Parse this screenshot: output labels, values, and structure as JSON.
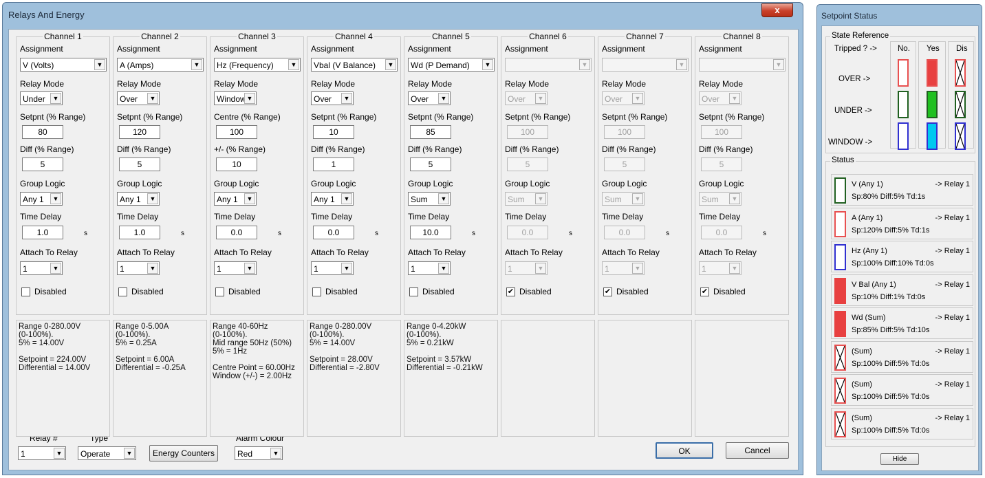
{
  "dialog": {
    "title": "Relays And Energy",
    "close_label": "x",
    "labels": {
      "assignment": "Assignment",
      "relay_mode": "Relay Mode",
      "time_delay": "Time Delay",
      "attach_to_relay": "Attach To Relay",
      "group_logic": "Group Logic",
      "disabled": "Disabled",
      "unit_seconds": "s"
    },
    "channels": [
      {
        "title": "Channel 1",
        "assignment": "V   (Volts)",
        "relay_mode": "Under",
        "sp_label": "Setpnt (% Range)",
        "sp_value": "80",
        "diff_label": "Diff (% Range)",
        "diff_value": "5",
        "group_logic": "Any 1",
        "time_delay": "1.0",
        "relay": "1",
        "disabled": false,
        "info": "Range 0-280.00V\n(0-100%).\n5% = 14.00V\n\nSetpoint = 224.00V\nDifferential = 14.00V"
      },
      {
        "title": "Channel 2",
        "assignment": "A   (Amps)",
        "relay_mode": "Over",
        "sp_label": "Setpnt (% Range)",
        "sp_value": "120",
        "diff_label": "Diff (% Range)",
        "diff_value": "5",
        "group_logic": "Any 1",
        "time_delay": "1.0",
        "relay": "1",
        "disabled": false,
        "info": "Range 0-5.00A\n(0-100%).\n5% = 0.25A\n\nSetpoint = 6.00A\nDifferential = -0.25A"
      },
      {
        "title": "Channel 3",
        "assignment": "Hz  (Frequency)",
        "relay_mode": "Window",
        "sp_label": "Centre (% Range)",
        "sp_value": "100",
        "diff_label": "+/- (% Range)",
        "diff_value": "10",
        "group_logic": "Any 1",
        "time_delay": "0.0",
        "relay": "1",
        "disabled": false,
        "info": "Range 40-60Hz\n(0-100%).\nMid range 50Hz (50%)\n5% = 1Hz\n\nCentre Point = 60.00Hz\nWindow (+/-) = 2.00Hz"
      },
      {
        "title": "Channel 4",
        "assignment": "Vbal (V Balance)",
        "relay_mode": "Over",
        "sp_label": "Setpnt (% Range)",
        "sp_value": "10",
        "diff_label": "Diff (% Range)",
        "diff_value": "1",
        "group_logic": "Any 1",
        "time_delay": "0.0",
        "relay": "1",
        "disabled": false,
        "info": "Range 0-280.00V\n(0-100%).\n5% = 14.00V\n\nSetpoint = 28.00V\nDifferential = -2.80V"
      },
      {
        "title": "Channel 5",
        "assignment": "Wd   (P Demand)",
        "relay_mode": "Over",
        "sp_label": "Setpnt (% Range)",
        "sp_value": "85",
        "diff_label": "Diff (% Range)",
        "diff_value": "5",
        "group_logic": "Sum",
        "time_delay": "10.0",
        "relay": "1",
        "disabled": false,
        "info": "Range 0-4.20kW\n(0-100%).\n5% = 0.21kW\n\nSetpoint = 3.57kW\nDifferential = -0.21kW"
      },
      {
        "title": "Channel 6",
        "assignment": "",
        "relay_mode": "Over",
        "sp_label": "Setpnt (% Range)",
        "sp_value": "100",
        "diff_label": "Diff (% Range)",
        "diff_value": "5",
        "group_logic": "Sum",
        "time_delay": "0.0",
        "relay": "1",
        "disabled": true,
        "info": ""
      },
      {
        "title": "Channel 7",
        "assignment": "",
        "relay_mode": "Over",
        "sp_label": "Setpnt (% Range)",
        "sp_value": "100",
        "diff_label": "Diff (% Range)",
        "diff_value": "5",
        "group_logic": "Sum",
        "time_delay": "0.0",
        "relay": "1",
        "disabled": true,
        "info": ""
      },
      {
        "title": "Channel 8",
        "assignment": "",
        "relay_mode": "Over",
        "sp_label": "Setpnt (% Range)",
        "sp_value": "100",
        "diff_label": "Diff (% Range)",
        "diff_value": "5",
        "group_logic": "Sum",
        "time_delay": "0.0",
        "relay": "1",
        "disabled": true,
        "info": ""
      }
    ],
    "bottom": {
      "relay_num_label": "Relay #",
      "relay_num_value": "1",
      "type_label": "Type",
      "type_value": "Operate",
      "energy_counters_label": "Energy Counters",
      "alarm_colour_label": "Alarm Colour",
      "alarm_colour_value": "Red",
      "ok_label": "OK",
      "cancel_label": "Cancel"
    }
  },
  "setpoint_status": {
    "title": "Setpoint Status",
    "state_reference": {
      "title": "State Reference",
      "tripped_label": "Tripped ? ->",
      "col_no": "No.",
      "col_yes": "Yes",
      "col_dis": "Dis",
      "row_over": "OVER ->",
      "row_under": "UNDER ->",
      "row_window": "WINDOW ->",
      "colors": {
        "over": "#e84040",
        "under": "#20c020",
        "window": "#00c8f0",
        "over_border": "#e85050",
        "under_border": "#206020",
        "window_border": "#3030d0"
      }
    },
    "status": {
      "title": "Status",
      "items": [
        {
          "line1": "V (Any 1)",
          "relay": "-> Relay 1",
          "line2": "Sp:80% Diff:5% Td:1s",
          "state": "under-no"
        },
        {
          "line1": "A (Any 1)",
          "relay": "-> Relay 1",
          "line2": "Sp:120% Diff:5% Td:1s",
          "state": "over-no"
        },
        {
          "line1": "Hz (Any 1)",
          "relay": "-> Relay 1",
          "line2": "Sp:100% Diff:10% Td:0s",
          "state": "window-no"
        },
        {
          "line1": "V Bal (Any 1)",
          "relay": "-> Relay 1",
          "line2": "Sp:10% Diff:1% Td:0s",
          "state": "over-yes"
        },
        {
          "line1": "Wd (Sum)",
          "relay": "-> Relay 1",
          "line2": "Sp:85% Diff:5% Td:10s",
          "state": "over-yes"
        },
        {
          "line1": "(Sum)",
          "relay": "-> Relay 1",
          "line2": "Sp:100% Diff:5% Td:0s",
          "state": "dis"
        },
        {
          "line1": "(Sum)",
          "relay": "-> Relay 1",
          "line2": "Sp:100% Diff:5% Td:0s",
          "state": "dis"
        },
        {
          "line1": "(Sum)",
          "relay": "-> Relay 1",
          "line2": "Sp:100% Diff:5% Td:0s",
          "state": "dis"
        }
      ]
    },
    "hide_label": "Hide"
  }
}
